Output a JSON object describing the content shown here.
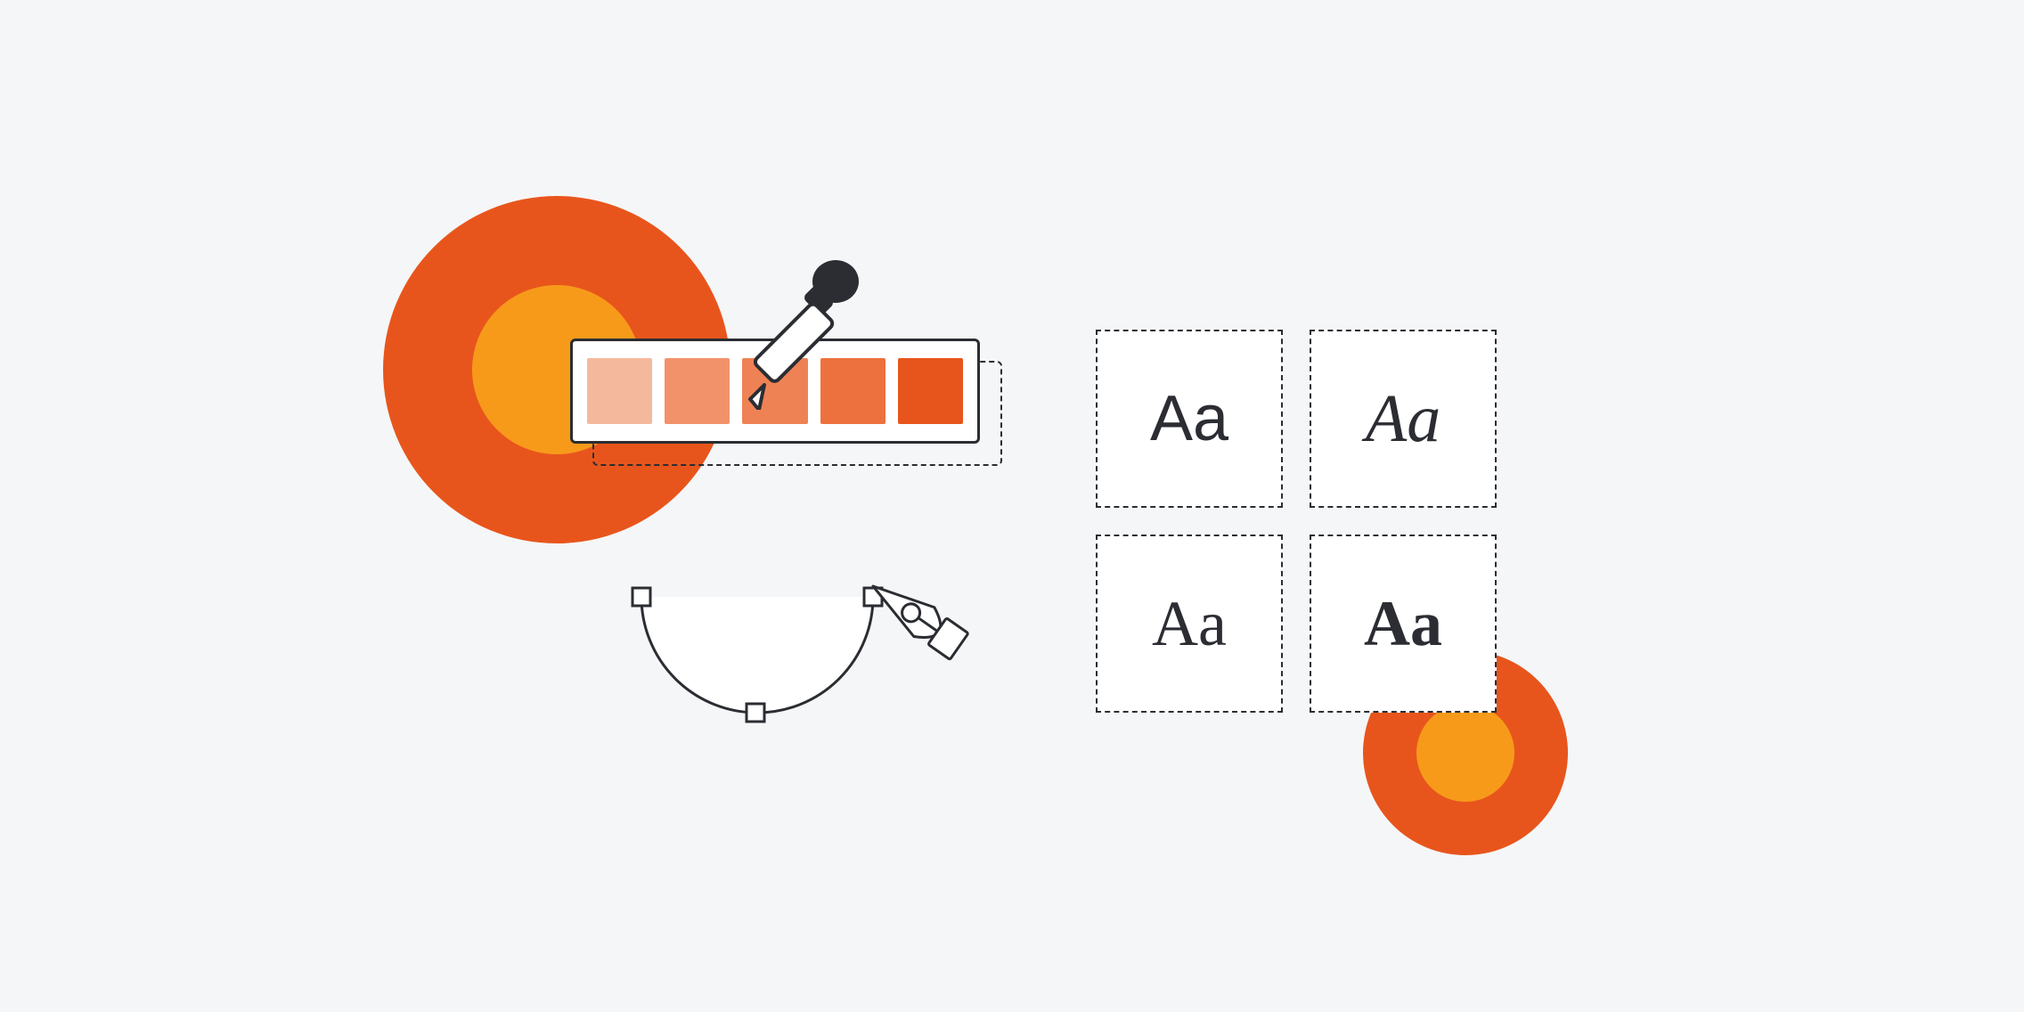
{
  "palette": {
    "swatches": [
      "#f4b99c",
      "#f2926b",
      "#ef8255",
      "#ed713e",
      "#e8551c"
    ]
  },
  "fonts": {
    "samples": [
      "Aa",
      "Aa",
      "Aa",
      "Aa"
    ]
  },
  "colors": {
    "orange_primary": "#e8551c",
    "orange_accent": "#f79a1a",
    "stroke": "#2b2d33",
    "background": "#f5f6f7"
  }
}
